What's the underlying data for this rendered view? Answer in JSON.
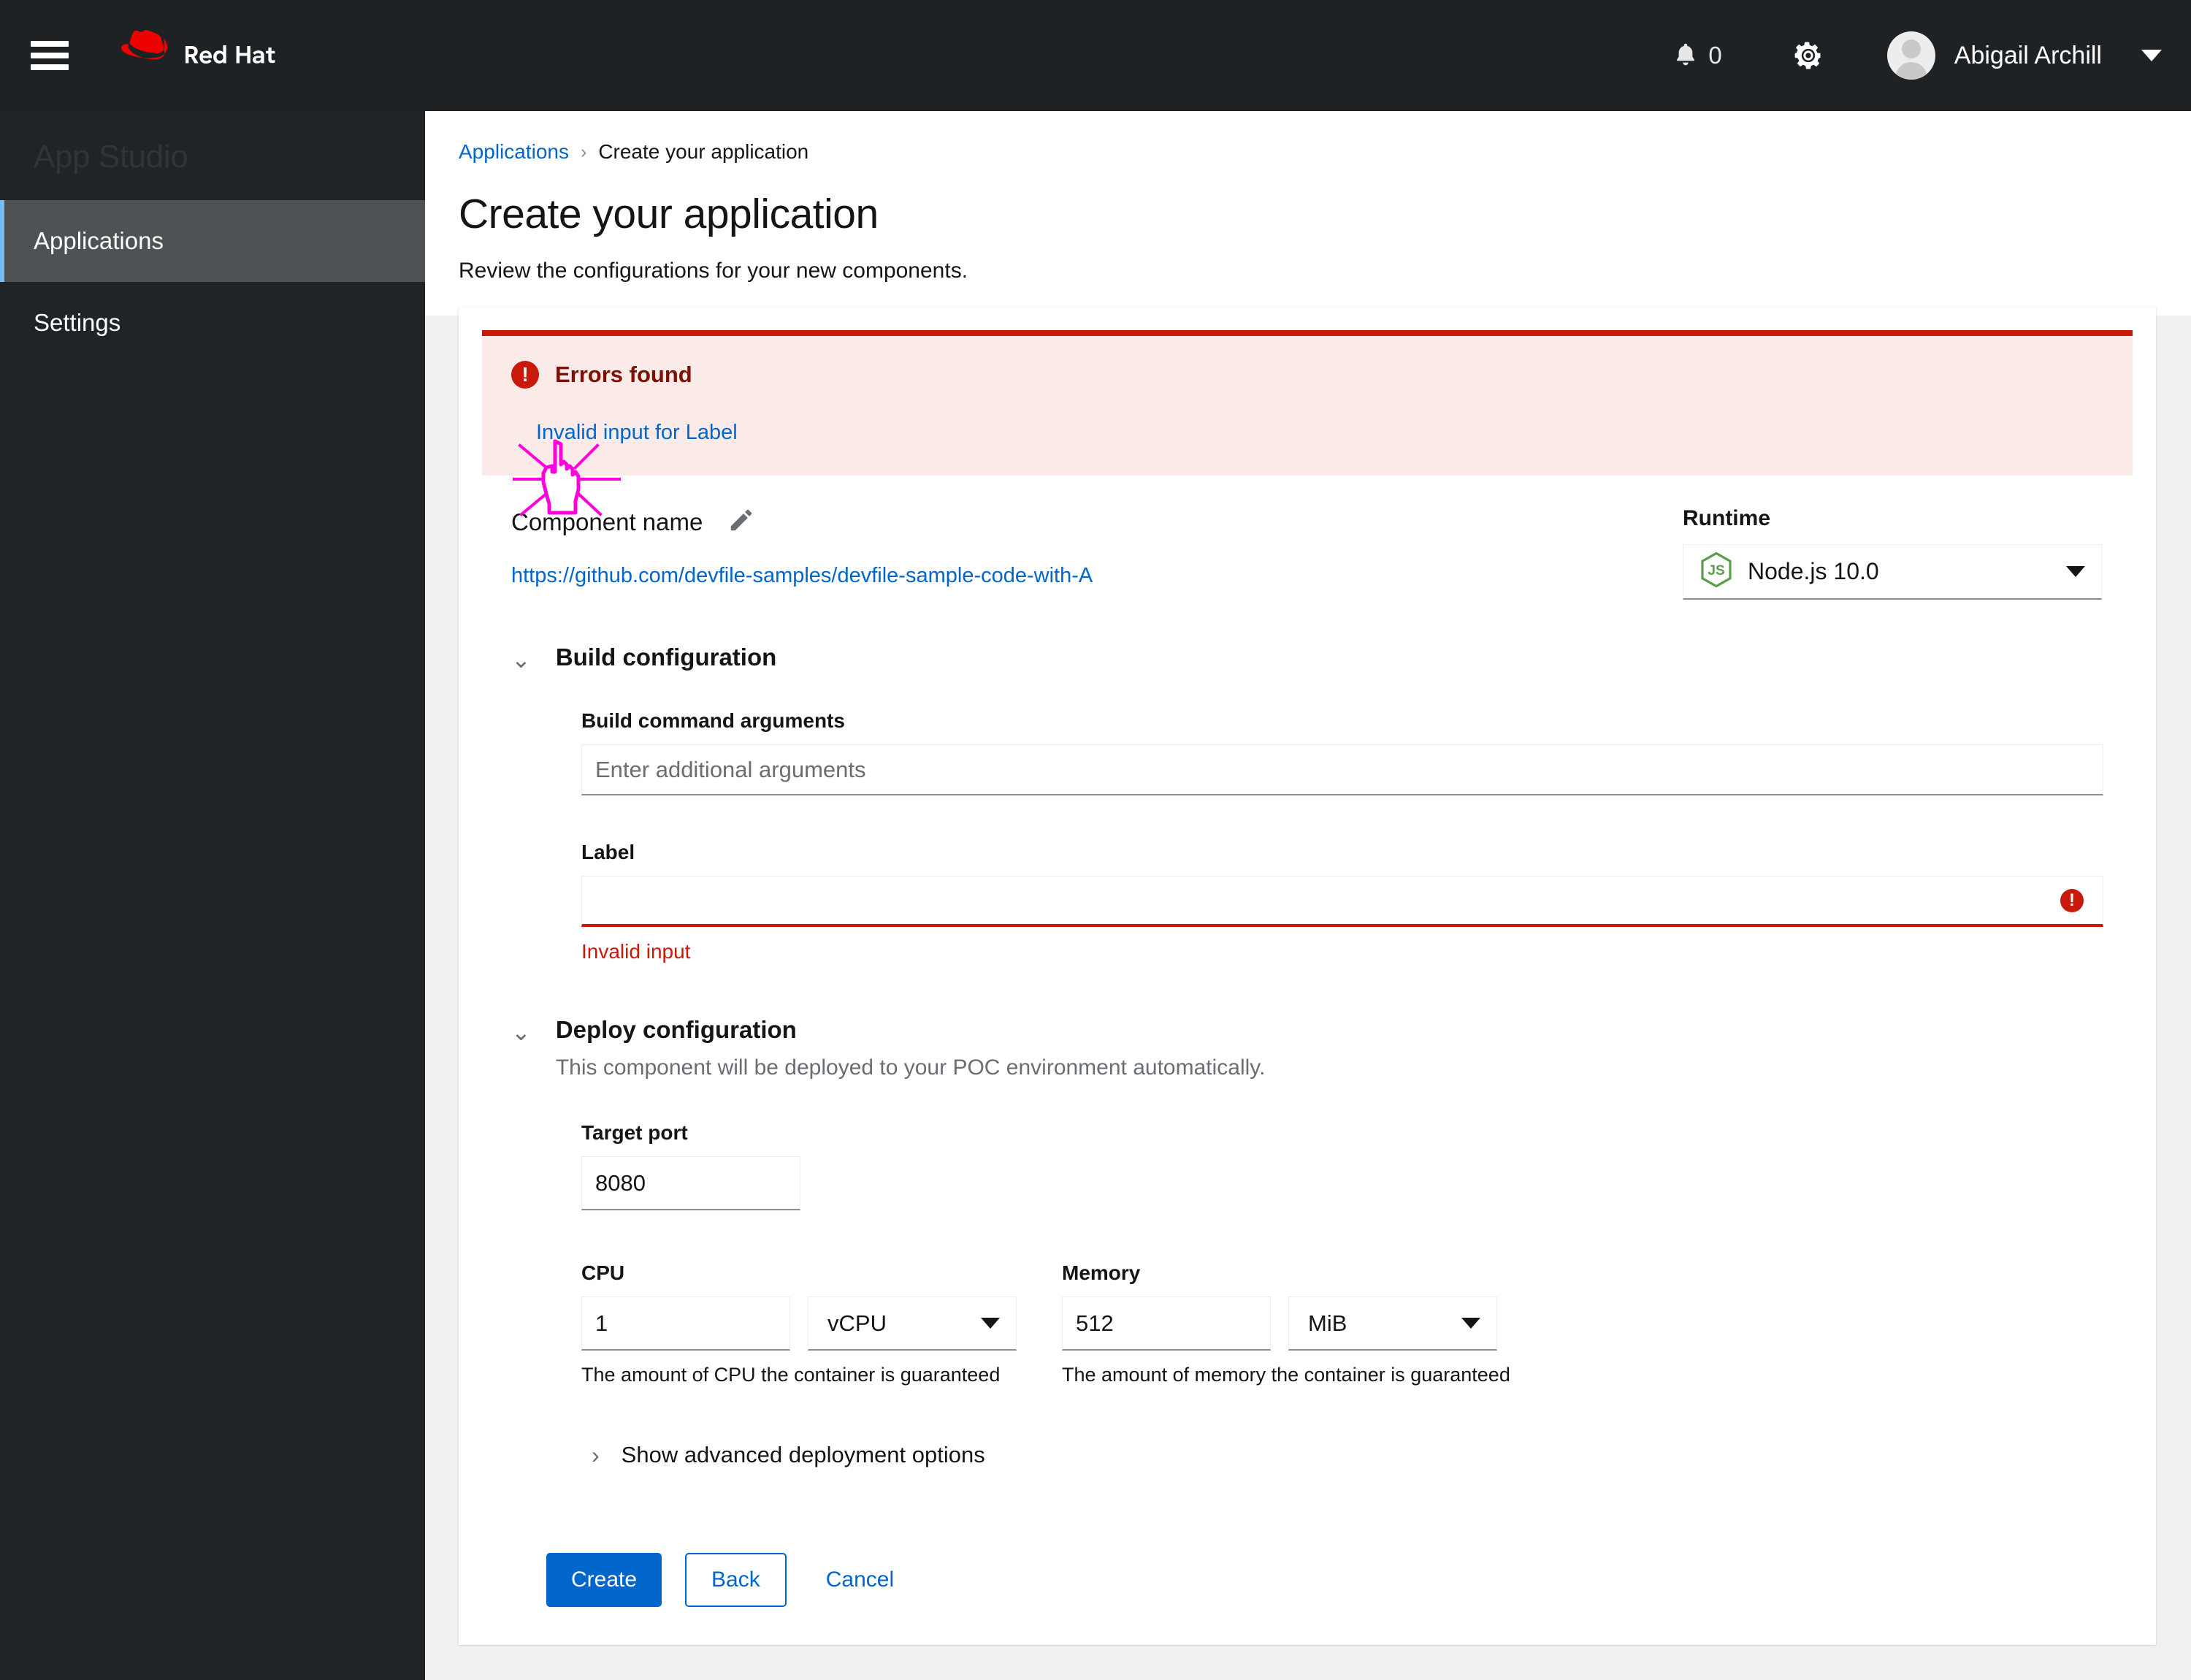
{
  "masthead": {
    "brand_name": "Red Hat",
    "hamburger_label": "Global navigation",
    "notification_count": "0",
    "username": "Abigail Archill"
  },
  "sidebar": {
    "title": "App Studio",
    "items": [
      {
        "label": "Applications",
        "active": true
      },
      {
        "label": "Settings",
        "active": false
      }
    ]
  },
  "page": {
    "breadcrumb": {
      "root": "Applications",
      "separator": "›",
      "current": "Create your application"
    },
    "title": "Create your application",
    "subtitle": "Review the configurations for your new components."
  },
  "alert": {
    "icon": "exclamation-circle-icon",
    "title": "Errors found",
    "link": "Invalid input for Label"
  },
  "component": {
    "name": "Component name",
    "edit_icon": "pencil-icon",
    "repo_url": "https://github.com/devfile-samples/devfile-sample-code-with-A"
  },
  "runtime": {
    "label": "Runtime",
    "icon": "nodejs-icon",
    "value": "Node.js 10.0",
    "caret": "chevron-down-icon"
  },
  "build_configuration": {
    "title": "Build configuration",
    "toggle": "⌄",
    "fields": {
      "build_args": {
        "label": "Build command arguments",
        "value": "",
        "placeholder": "Enter additional arguments"
      },
      "label_field": {
        "label": "Label",
        "value": "",
        "error": "Invalid input",
        "error_icon": "exclamation-circle-icon"
      }
    }
  },
  "deploy_configuration": {
    "title": "Deploy configuration",
    "toggle": "⌄",
    "description": "This component will be deployed to your POC environment automatically.",
    "target_port": {
      "label": "Target port",
      "value": "8080"
    },
    "cpu": {
      "label": "CPU",
      "value": "1",
      "unit": "vCPU",
      "help": "The amount of CPU the container is guaranteed"
    },
    "memory": {
      "label": "Memory",
      "value": "512",
      "unit": "MiB",
      "help": "The amount of memory the container is guaranteed"
    },
    "advanced_toggle": {
      "chevron": "›",
      "label": "Show advanced deployment options"
    }
  },
  "actions": {
    "create": "Create",
    "back": "Back",
    "cancel": "Cancel"
  },
  "colors": {
    "brand_red": "#ee0000",
    "masthead_bg": "#1f2225",
    "sidebar_bg": "#212427",
    "sidebar_active_bg": "#4f5255",
    "accent_blue": "#0066cc",
    "danger_red": "#c9190b",
    "alert_bg": "#faeae8",
    "cursor_magenta": "#ff00dd",
    "nodejs_green": "#5a9e4b"
  }
}
